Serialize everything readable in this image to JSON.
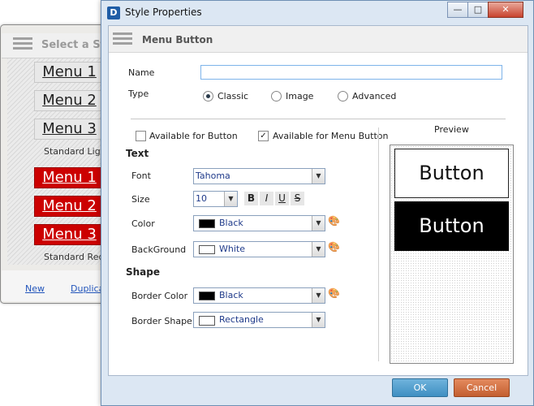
{
  "bg_window": {
    "title": "Select a Style",
    "groups": [
      {
        "label": "Standard Light",
        "items": [
          "Menu 1",
          "Menu 2",
          "Menu 3"
        ]
      },
      {
        "label": "Standard Red",
        "items": [
          "Menu 1",
          "Menu 2",
          "Menu 3"
        ]
      }
    ],
    "links": {
      "new": "New",
      "duplicate": "Duplicate"
    }
  },
  "dialog": {
    "title": "Style Properties",
    "app_icon": "D",
    "controls": {
      "minimize": "—",
      "maximize": "□",
      "close": "✕"
    },
    "section_title": "Menu Button",
    "name_label": "Name",
    "name_value": "",
    "type_label": "Type",
    "type_options": [
      "Classic",
      "Image",
      "Advanced"
    ],
    "type_selected": "Classic",
    "available_for_button": {
      "label": "Available for Button",
      "checked": false
    },
    "available_for_menu_button": {
      "label": "Available for Menu Button",
      "checked": true
    },
    "text_header": "Text",
    "font_label": "Font",
    "font_value": "Tahoma",
    "size_label": "Size",
    "size_value": "10",
    "format_buttons": [
      "B",
      "I",
      "U",
      "S"
    ],
    "color_label": "Color",
    "color_value": "Black",
    "color_swatch": "#000000",
    "background_label": "BackGround",
    "background_value": "White",
    "background_swatch": "#ffffff",
    "shape_header": "Shape",
    "border_color_label": "Border Color",
    "border_color_value": "Black",
    "border_color_swatch": "#000000",
    "border_shape_label": "Border Shape",
    "border_shape_value": "Rectangle",
    "preview_label": "Preview",
    "preview_normal": "Button",
    "preview_hover": "Button",
    "ok_label": "OK",
    "cancel_label": "Cancel",
    "colors": {
      "ok": "#4f9fd0",
      "cancel": "#d27040",
      "title_bg": "#dce7f3"
    }
  }
}
